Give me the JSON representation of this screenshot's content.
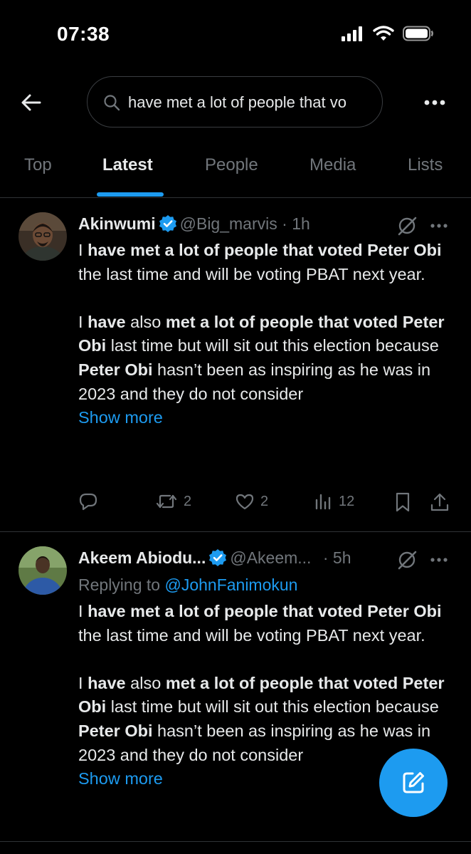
{
  "status_bar": {
    "time": "07:38"
  },
  "search": {
    "query": "have met a lot of people that vo"
  },
  "tabs": [
    {
      "label": "Top"
    },
    {
      "label": "Latest"
    },
    {
      "label": "People"
    },
    {
      "label": "Media"
    },
    {
      "label": "Lists"
    }
  ],
  "active_tab": "Latest",
  "tweets": [
    {
      "name": "Akinwumi",
      "handle": "@Big_marvis",
      "separator": "·",
      "age": "1h",
      "body_html": "I <b>have met a lot of people that voted Peter Obi</b> the last time and will be voting PBAT next year.<br><br>I <b>have</b> also <b>met a lot of people that voted Peter Obi</b> last time but will sit out this election because <b>Peter Obi</b> hasn’t been as inspiring as he was in 2023 and they do not consider",
      "show_more": "Show more",
      "reposts": "2",
      "likes": "2",
      "views": "12"
    },
    {
      "name": "Akeem Abiodu...",
      "handle": "@Akeem...",
      "separator": "·",
      "age": "5h",
      "replying_label": "Replying to",
      "replying_to": "@JohnFanimokun",
      "body_html": "I <b>have met a lot of people that voted Peter Obi</b> the last time and will be voting PBAT next year.<br><br>I <b>have</b> also <b>met a lot of people that voted Peter Obi</b> last time but will sit out this election because <b>Peter Obi</b> hasn’t been as inspiring as he was in 2023 and they do not consider",
      "show_more": "Show more"
    }
  ],
  "colors": {
    "background": "#000000",
    "accent": "#1d9bf0",
    "text": "#e7e9ea",
    "muted": "#71767b",
    "divider": "#2f3336"
  }
}
